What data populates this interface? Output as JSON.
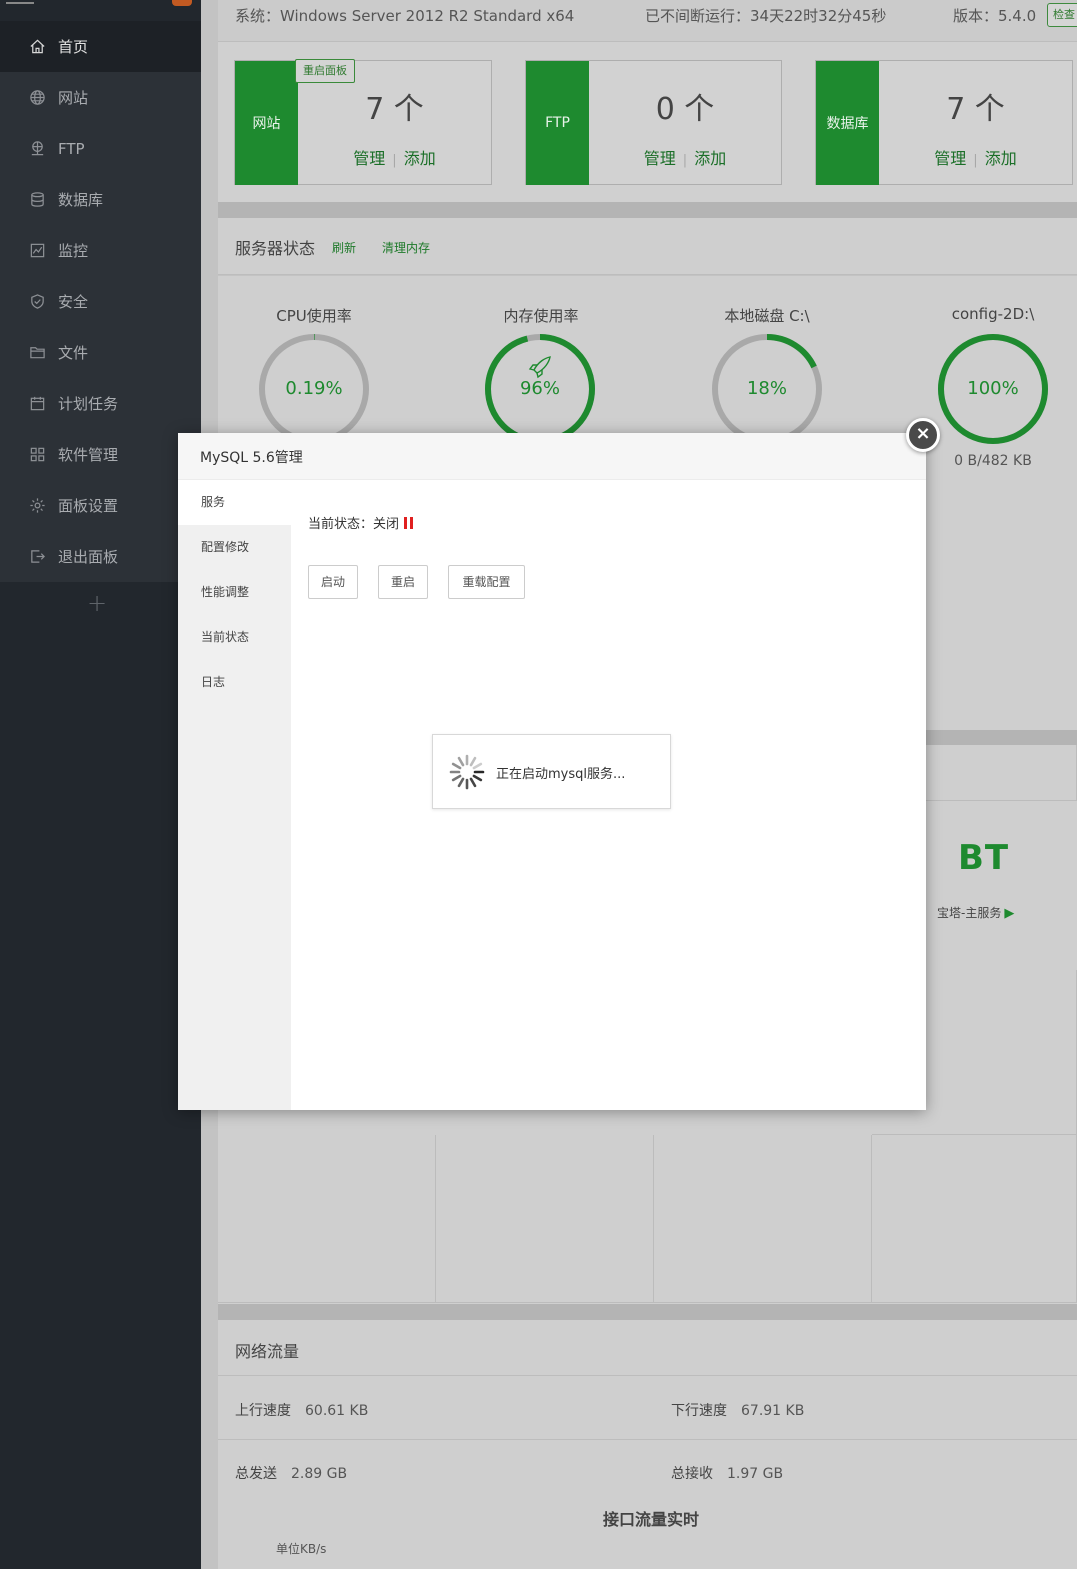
{
  "sidebar": {
    "items": [
      {
        "label": "首页",
        "icon": "home-icon",
        "active": true
      },
      {
        "label": "网站",
        "icon": "globe-icon"
      },
      {
        "label": "FTP",
        "icon": "ftp-icon"
      },
      {
        "label": "数据库",
        "icon": "database-icon"
      },
      {
        "label": "监控",
        "icon": "monitor-icon"
      },
      {
        "label": "安全",
        "icon": "shield-icon"
      },
      {
        "label": "文件",
        "icon": "folder-icon"
      },
      {
        "label": "计划任务",
        "icon": "calendar-icon"
      },
      {
        "label": "软件管理",
        "icon": "grid-icon"
      },
      {
        "label": "面板设置",
        "icon": "gear-icon"
      },
      {
        "label": "退出面板",
        "icon": "logout-icon"
      }
    ],
    "add_symbol": "+"
  },
  "topbar": {
    "system": "系统：Windows Server 2012 R2 Standard x64",
    "uptime": "已不间断运行：34天22时32分45秒",
    "version": "版本：5.4.0",
    "check_label": "检查"
  },
  "stats": {
    "restart_panel": "重启面板",
    "boxes": [
      {
        "label": "网站",
        "count": "7 个",
        "manage": "管理",
        "add": "添加"
      },
      {
        "label": "FTP",
        "count": "0 个",
        "manage": "管理",
        "add": "添加"
      },
      {
        "label": "数据库",
        "count": "7 个",
        "manage": "管理",
        "add": "添加"
      }
    ]
  },
  "server_status": {
    "title": "服务器状态",
    "refresh": "刷新",
    "clear_memory": "清理内存",
    "gauges": [
      {
        "label": "CPU使用率",
        "value": "0.19%",
        "percent": 0.19
      },
      {
        "label": "内存使用率",
        "value": "96%",
        "percent": 96
      },
      {
        "label": "本地磁盘 C:\\",
        "value": "18%",
        "percent": 18
      },
      {
        "label": "config-2D:\\",
        "value": "100%",
        "percent": 100,
        "sub": "0 B/482 KB"
      }
    ]
  },
  "software": {
    "bt_logo": "BT",
    "bt_service": "宝塔-主服务"
  },
  "network": {
    "title": "网络流量",
    "up_label": "上行速度",
    "up_value": "60.61 KB",
    "down_label": "下行速度",
    "down_value": "67.91 KB",
    "sent_label": "总发送",
    "sent_value": "2.89 GB",
    "recv_label": "总接收",
    "recv_value": "1.97 GB",
    "chart_title": "接口流量实时",
    "unit": "单位KB/s"
  },
  "modal": {
    "title": "MySQL 5.6管理",
    "tabs": [
      "服务",
      "配置修改",
      "性能调整",
      "当前状态",
      "日志"
    ],
    "status_label": "当前状态：",
    "status_value": "关闭",
    "buttons": {
      "start": "启动",
      "restart": "重启",
      "reload": "重载配置"
    },
    "loading": "正在启动mysql服务...",
    "close_symbol": "×"
  },
  "colors": {
    "accent": "#1e8a2f",
    "sidebar": "#22272d",
    "stopped": "#e02020"
  }
}
